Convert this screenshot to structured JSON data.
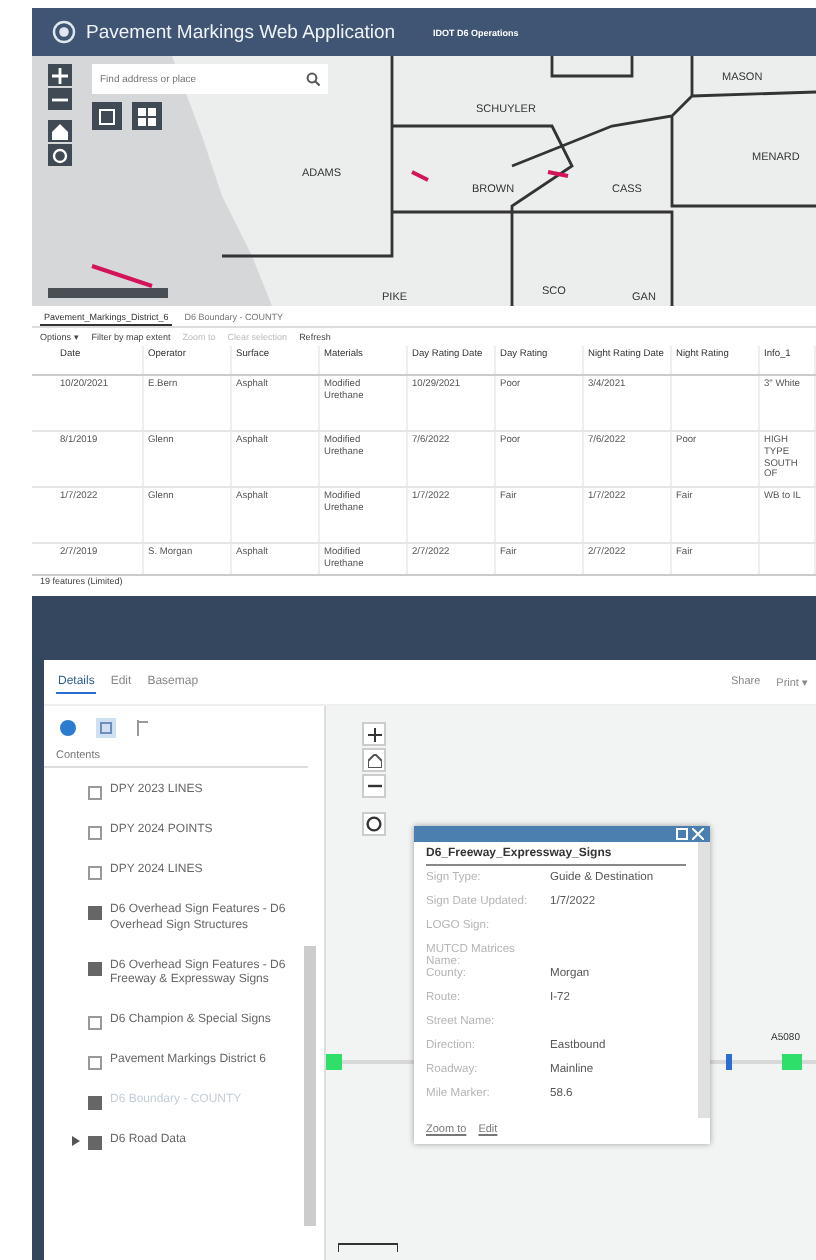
{
  "header": {
    "title": "Pavement Markings Web Application",
    "subtitle": "IDOT D6 Operations"
  },
  "top_map": {
    "search": {
      "placeholder": "Find address or place"
    },
    "labels": [
      "MASON",
      "SCHUYLER",
      "MENARD",
      "ADAMS",
      "BROWN",
      "CASS",
      "PIKE",
      "SCO",
      "GAN"
    ]
  },
  "attribute_table": {
    "tabs": [
      {
        "label": "Pavement_Markings_District_6",
        "selected": true
      },
      {
        "label": "D6 Boundary - COUNTY",
        "selected": false
      }
    ],
    "toolbar": [
      {
        "label": "Options ▾",
        "disabled": false
      },
      {
        "label": "Filter by map extent",
        "disabled": false
      },
      {
        "label": "Zoom to",
        "disabled": true
      },
      {
        "label": "Clear selection",
        "disabled": true
      },
      {
        "label": "Refresh",
        "disabled": false
      }
    ],
    "columns": [
      "Date",
      "Operator",
      "Surface",
      "Materials",
      "Day Rating Date",
      "Day Rating",
      "Night Rating Date",
      "Night Rating",
      "Info_1"
    ],
    "rows": [
      [
        "10/20/2021",
        "E.Bern",
        "Asphalt",
        "Modified Urethane",
        "10/29/2021",
        "Poor",
        "3/4/2021",
        "",
        "3\" White"
      ],
      [
        "8/1/2019",
        "Glenn",
        "Asphalt",
        "Modified Urethane",
        "7/6/2022",
        "Poor",
        "7/6/2022",
        "Poor",
        "HIGH TYPE SOUTH OF"
      ],
      [
        "1/7/2022",
        "Glenn",
        "Asphalt",
        "Modified Urethane",
        "1/7/2022",
        "Fair",
        "1/7/2022",
        "Fair",
        "WB to IL"
      ],
      [
        "2/7/2019",
        "S. Morgan",
        "Asphalt",
        "Modified Urethane",
        "2/7/2022",
        "Fair",
        "2/7/2022",
        "Fair",
        ""
      ]
    ],
    "footer": "19 features (Limited)"
  },
  "panel": {
    "tabs": [
      {
        "label": "Details",
        "selected": true
      },
      {
        "label": "Edit",
        "selected": false
      },
      {
        "label": "Basemap",
        "selected": false
      }
    ],
    "toolbar": [
      "Share",
      "Print ▾"
    ],
    "contents_label": "Contents",
    "layers": [
      {
        "label": "DPY 2023 LINES",
        "checked": false,
        "disabled": false,
        "expandable": false
      },
      {
        "label": "DPY 2024 POINTS",
        "checked": false,
        "disabled": false,
        "expandable": false
      },
      {
        "label": "DPY 2024 LINES",
        "checked": false,
        "disabled": false,
        "expandable": false
      },
      {
        "label": "D6 Overhead Sign Features - D6 Overhead Sign Structures",
        "checked": true,
        "disabled": false,
        "expandable": false
      },
      {
        "label": "D6 Overhead Sign Features - D6 Freeway & Expressway Signs",
        "checked": true,
        "disabled": false,
        "expandable": false
      },
      {
        "label": "D6 Champion & Special Signs",
        "checked": false,
        "disabled": false,
        "expandable": false
      },
      {
        "label": "Pavement Markings District 6",
        "checked": false,
        "disabled": false,
        "expandable": false
      },
      {
        "label": "D6 Boundary - COUNTY",
        "checked": true,
        "disabled": true,
        "expandable": false
      },
      {
        "label": "D6 Road Data",
        "checked": true,
        "disabled": false,
        "expandable": true
      }
    ]
  },
  "popup": {
    "title": "D6_Freeway_Expressway_Signs",
    "fields": [
      {
        "label": "Sign Type:",
        "value": "Guide & Destination"
      },
      {
        "label": "Sign Date Updated:",
        "value": "1/7/2022"
      },
      {
        "label": "LOGO Sign:"
      },
      {
        "label": "MUTCD Matrices Name:"
      },
      {
        "label": "County:",
        "value": "Morgan"
      },
      {
        "label": "Route:",
        "value": "I-72"
      },
      {
        "label": "Street Name:"
      },
      {
        "label": "Direction:",
        "value": "Eastbound"
      },
      {
        "label": "Roadway:",
        "value": "Mainline"
      },
      {
        "label": "Mile Marker:",
        "value": "58.6"
      }
    ],
    "links": [
      "Zoom to",
      "Edit"
    ]
  },
  "map_label": "A5080"
}
